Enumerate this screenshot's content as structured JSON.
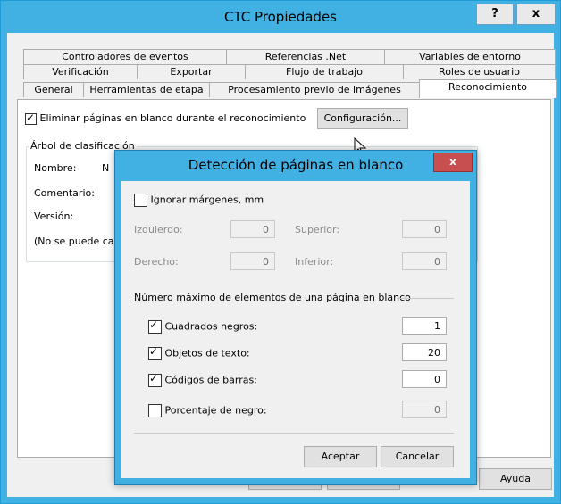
{
  "window": {
    "title": "CTC Propiedades",
    "help_label": "?",
    "close_label": "x",
    "ayuda_label": "Ayuda"
  },
  "tabs": {
    "row1": [
      "Controladores de eventos",
      "Referencias .Net",
      "Variables de entorno"
    ],
    "row2": [
      "Verificación",
      "Exportar",
      "Flujo de trabajo",
      "Roles de usuario"
    ],
    "row3": [
      "General",
      "Herramientas de etapa",
      "Procesamiento previo de imágenes",
      "Reconocimiento"
    ]
  },
  "reconocimiento": {
    "eliminar_label": "Eliminar páginas en blanco durante el reconocimiento",
    "eliminar_checked": true,
    "config_button": "Configuración...",
    "group_title": "Árbol de clasificación",
    "nombre_label": "Nombre:",
    "nombre_value": "N",
    "comentario_label": "Comentario:",
    "version_label": "Versión:",
    "note": "(No se puede ca"
  },
  "dialog": {
    "title": "Detección de páginas en blanco",
    "close_label": "x",
    "ignorar_label": "Ignorar márgenes, mm",
    "ignorar_checked": false,
    "izquierdo_label": "Izquierdo:",
    "izquierdo_value": "0",
    "superior_label": "Superior:",
    "superior_value": "0",
    "derecho_label": "Derecho:",
    "derecho_value": "0",
    "inferior_label": "Inferior:",
    "inferior_value": "0",
    "max_label": "Número máximo de elementos de una página en blanco",
    "cuadrados_label": "Cuadrados negros:",
    "cuadrados_value": "1",
    "objetos_label": "Objetos de texto:",
    "objetos_value": "20",
    "codigos_label": "Códigos de barras:",
    "codigos_value": "0",
    "porcentaje_label": "Porcentaje de negro:",
    "porcentaje_value": "0",
    "aceptar_label": "Aceptar",
    "cancelar_label": "Cancelar"
  }
}
